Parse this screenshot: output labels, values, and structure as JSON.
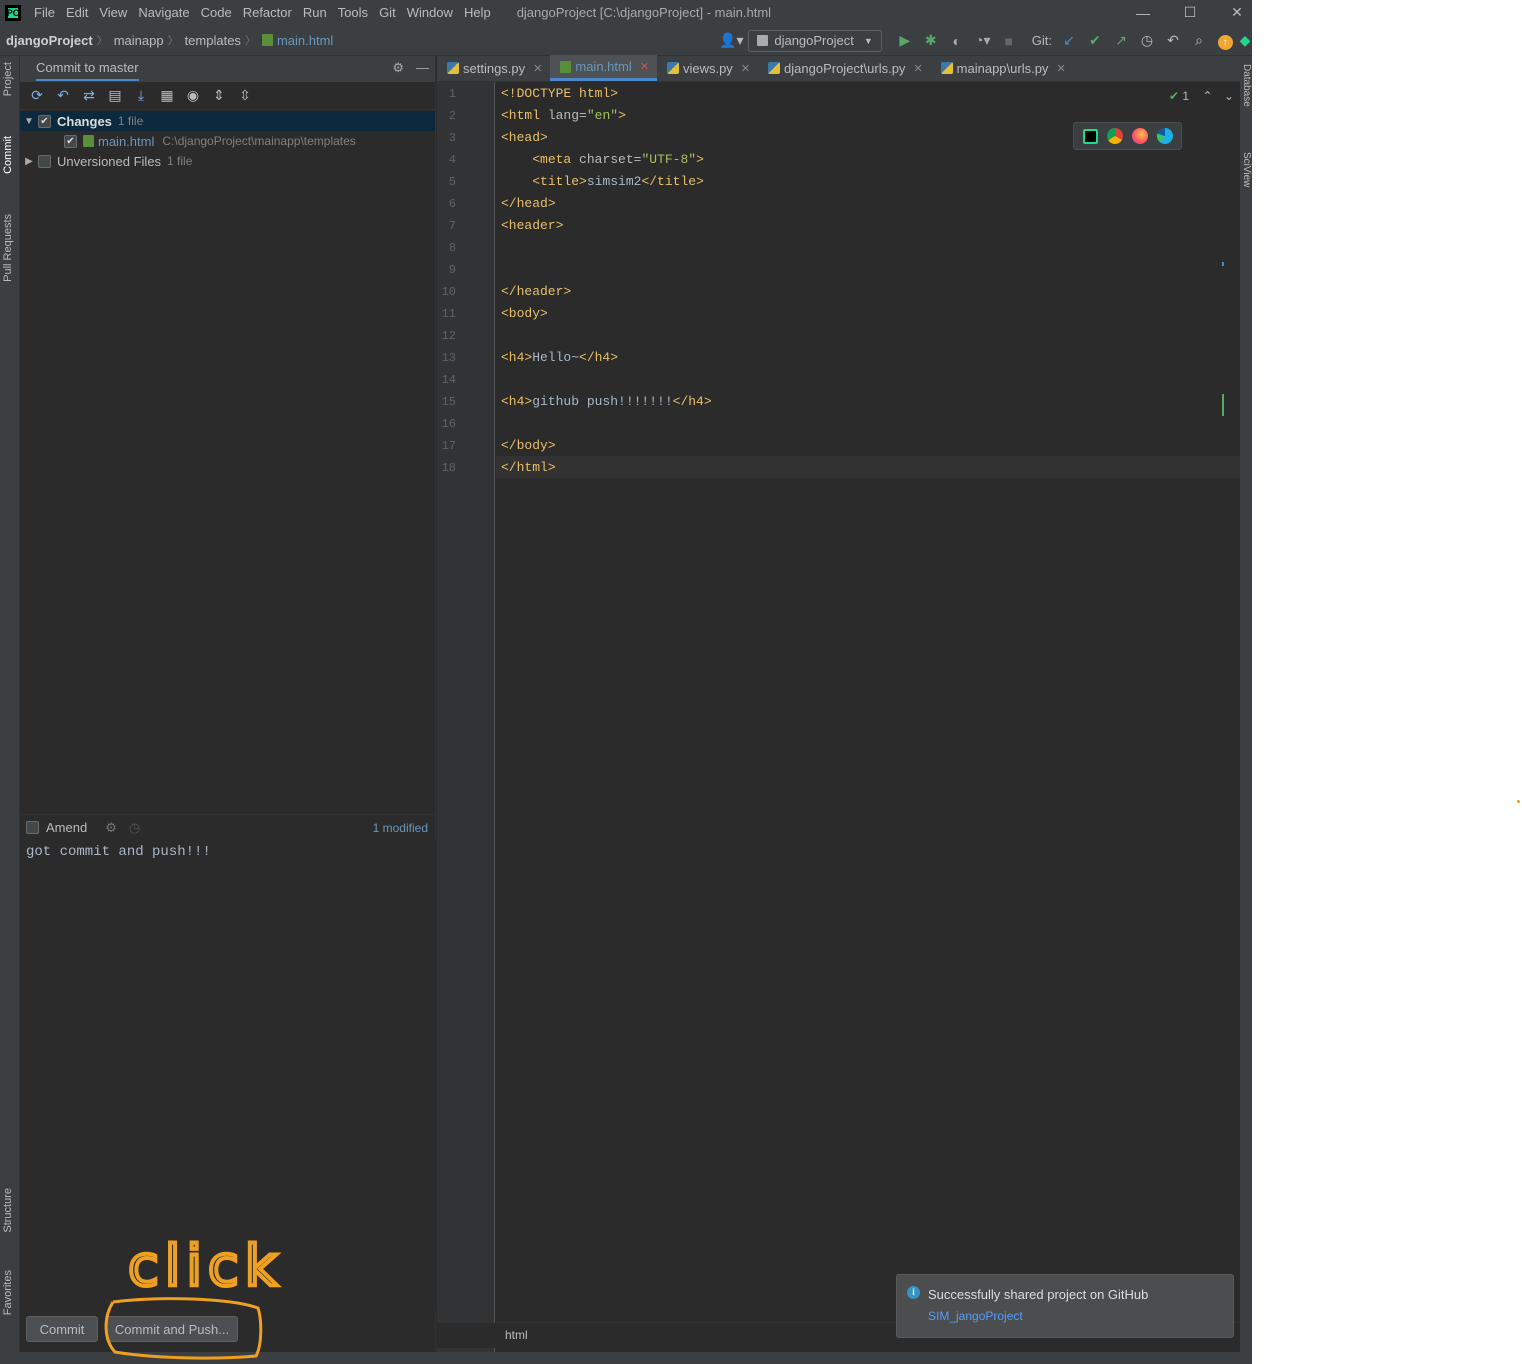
{
  "window": {
    "title": "djangoProject [C:\\djangoProject] - main.html",
    "controls": [
      "minimize-icon",
      "maximize-icon",
      "close-icon"
    ]
  },
  "menu": [
    "File",
    "Edit",
    "View",
    "Navigate",
    "Code",
    "Refactor",
    "Run",
    "Tools",
    "Git",
    "Window",
    "Help"
  ],
  "breadcrumb": [
    "djangoProject",
    "mainapp",
    "templates",
    "main.html"
  ],
  "toolbar": {
    "run_config": "djangoProject",
    "git_label": "Git:"
  },
  "sidebar_left": [
    "Project",
    "Commit",
    "Pull Requests",
    "Structure",
    "Favorites"
  ],
  "sidebar_right": [
    "Database",
    "SciView"
  ],
  "commit_panel": {
    "title": "Commit to master",
    "changes_label": "Changes",
    "changes_count": "1 file",
    "file_name": "main.html",
    "file_path": "C:\\djangoProject\\mainapp\\templates",
    "unversioned_label": "Unversioned Files",
    "unversioned_count": "1 file",
    "amend_label": "Amend",
    "modified_label": "1 modified",
    "message": "got commit and push!!!",
    "commit_button": "Commit",
    "commit_push_button": "Commit and Push..."
  },
  "tabs": [
    {
      "label": "settings.py",
      "active": false
    },
    {
      "label": "main.html",
      "active": true
    },
    {
      "label": "views.py",
      "active": false
    },
    {
      "label": "djangoProject\\urls.py",
      "active": false
    },
    {
      "label": "mainapp\\urls.py",
      "active": false
    }
  ],
  "editor": {
    "line_numbers": [
      "1",
      "2",
      "3",
      "4",
      "5",
      "6",
      "7",
      "8",
      "9",
      "10",
      "11",
      "12",
      "13",
      "14",
      "15",
      "16",
      "17",
      "18"
    ],
    "lines": [
      "<!DOCTYPE html>",
      "<html lang=\"en\">",
      "<head>",
      "    <meta charset=\"UTF-8\">",
      "    <title>simsim2</title>",
      "</head>",
      "<header>",
      "",
      "",
      "</header>",
      "<body>",
      "",
      "<h4>Hello~</h4>",
      "",
      "<h4>github push!!!!!!!</h4>",
      "",
      "</body>",
      "</html>"
    ],
    "inspection_count": "1",
    "breadcrumb_footer": "html"
  },
  "notification": {
    "title": "Successfully shared project on GitHub",
    "link": "SIM_jangoProject"
  },
  "annotation": {
    "text": "click",
    "color": "#f0a020"
  },
  "colors": {
    "accent": "#4a88c7",
    "bg": "#2b2b2b",
    "panel": "#3c3f41",
    "tag": "#e8bf6a",
    "attr_value": "#a5c261"
  }
}
